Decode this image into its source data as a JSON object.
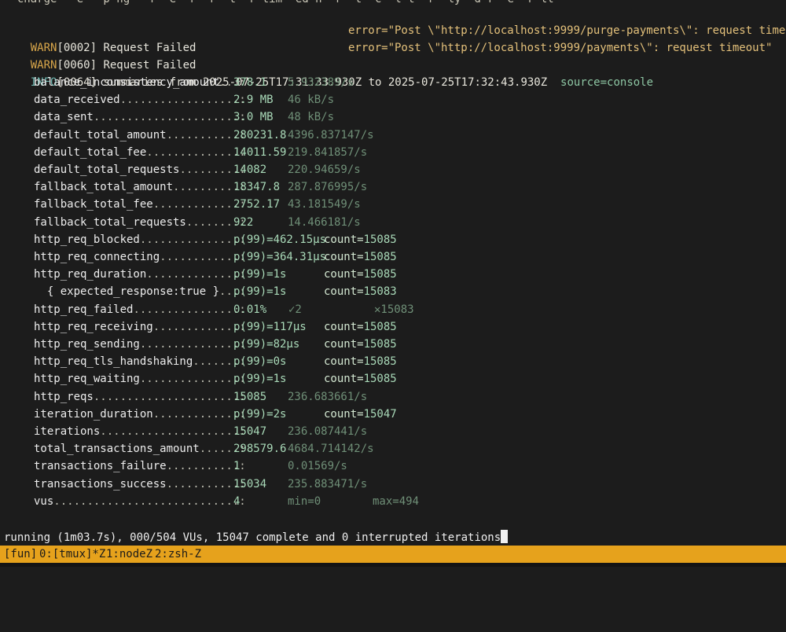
{
  "top_cut": "  charge   e   p ng   r  e  r  r  t  r tim  ed n  r  t  c  l t  r  ly  d r  e  r ll ",
  "log": [
    {
      "tag": "WARN",
      "id": "[0002]",
      "msg": " Request Failed",
      "kv": "error=\"Post \\\"http://localhost:9999/purge-payments\\\": request timeout\""
    },
    {
      "tag": "WARN",
      "id": "[0060]",
      "msg": " Request Failed",
      "kv": "error=\"Post \\\"http://localhost:9999/payments\\\": request timeout\""
    }
  ],
  "info": {
    "tag": "INFO",
    "id": "[0064]",
    "msg": " summaries from 2025-07-25T17:31:33.930Z to 2025-07-25T17:32:43.930Z",
    "kv": "source=console"
  },
  "metrics": [
    {
      "name": "balance_inconsistency_amount",
      "dots": "...:",
      "v1": "378.1",
      "v2": "5.932389/s"
    },
    {
      "name": "data_received",
      "dots": "..................:",
      "v1": "2.9 MB",
      "v2": "46 kB/s"
    },
    {
      "name": "data_sent",
      "dots": "......................:",
      "v1": "3.0 MB",
      "v2": "48 kB/s"
    },
    {
      "name": "default_total_amount",
      "dots": "...........:",
      "v1": "280231.8",
      "v2": "4396.837147/s"
    },
    {
      "name": "default_total_fee",
      "dots": "..............:",
      "v1": "14011.59",
      "v2": "219.841857/s"
    },
    {
      "name": "default_total_requests",
      "dots": ".........:",
      "v1": "14082",
      "v2": "220.94659/s"
    },
    {
      "name": "fallback_total_amount",
      "dots": "..........:",
      "v1": "18347.8",
      "v2": "287.876995/s"
    },
    {
      "name": "fallback_total_fee",
      "dots": ".............:",
      "v1": "2752.17",
      "v2": "43.181549/s"
    },
    {
      "name": "fallback_total_requests",
      "dots": "........:",
      "v1": "922",
      "v2": "14.466181/s"
    },
    {
      "name": "http_req_blocked",
      "dots": "...............:",
      "v1": "p(99)=462.15µs",
      "count": "15085"
    },
    {
      "name": "http_req_connecting",
      "dots": "............:",
      "v1": "p(99)=364.31µs",
      "count": "15085"
    },
    {
      "name": "http_req_duration",
      "dots": "..............:",
      "v1": "p(99)=1s",
      "count": "15085"
    },
    {
      "name": "  { expected_response:true }",
      "dots": "...:",
      "v1": "p(99)=1s",
      "count": "15083"
    },
    {
      "name": "http_req_failed",
      "dots": "................:",
      "v1": "0.01%",
      "ok": "✓2",
      "bad": "✕15083"
    },
    {
      "name": "http_req_receiving",
      "dots": ".............:",
      "v1": "p(99)=117µs",
      "count": "15085"
    },
    {
      "name": "http_req_sending",
      "dots": "...............:",
      "v1": "p(99)=82µs",
      "count": "15085"
    },
    {
      "name": "http_req_tls_handshaking",
      "dots": ".......:",
      "v1": "p(99)=0s",
      "count": "15085"
    },
    {
      "name": "http_req_waiting",
      "dots": "...............:",
      "v1": "p(99)=1s",
      "count": "15085"
    },
    {
      "name": "http_reqs",
      "dots": "......................:",
      "v1": "15085",
      "v2": "236.683661/s"
    },
    {
      "name": "iteration_duration",
      "dots": ".............:",
      "v1": "p(99)=2s",
      "count": "15047"
    },
    {
      "name": "iterations",
      "dots": ".....................:",
      "v1": "15047",
      "v2": "236.087441/s"
    },
    {
      "name": "total_transactions_amount",
      "dots": "......:",
      "v1": "298579.6",
      "v2": "4684.714142/s"
    },
    {
      "name": "transactions_failure",
      "dots": "...........:",
      "v1": "1",
      "v2": "0.01569/s"
    },
    {
      "name": "transactions_success",
      "dots": "...........:",
      "v1": "15034",
      "v2": "235.883471/s"
    },
    {
      "name": "vus",
      "dots": "............................:",
      "v1": "4",
      "min": "min=0",
      "max": "max=494"
    }
  ],
  "running": "running (1m03.7s), 000/504 VUs, 15047 complete and 0 interrupted iterations",
  "status": {
    "session": "[fun]",
    "win0": "0:[tmux]*Z",
    "win1": "1:nodeZ",
    "win2": "2:zsh-Z"
  }
}
